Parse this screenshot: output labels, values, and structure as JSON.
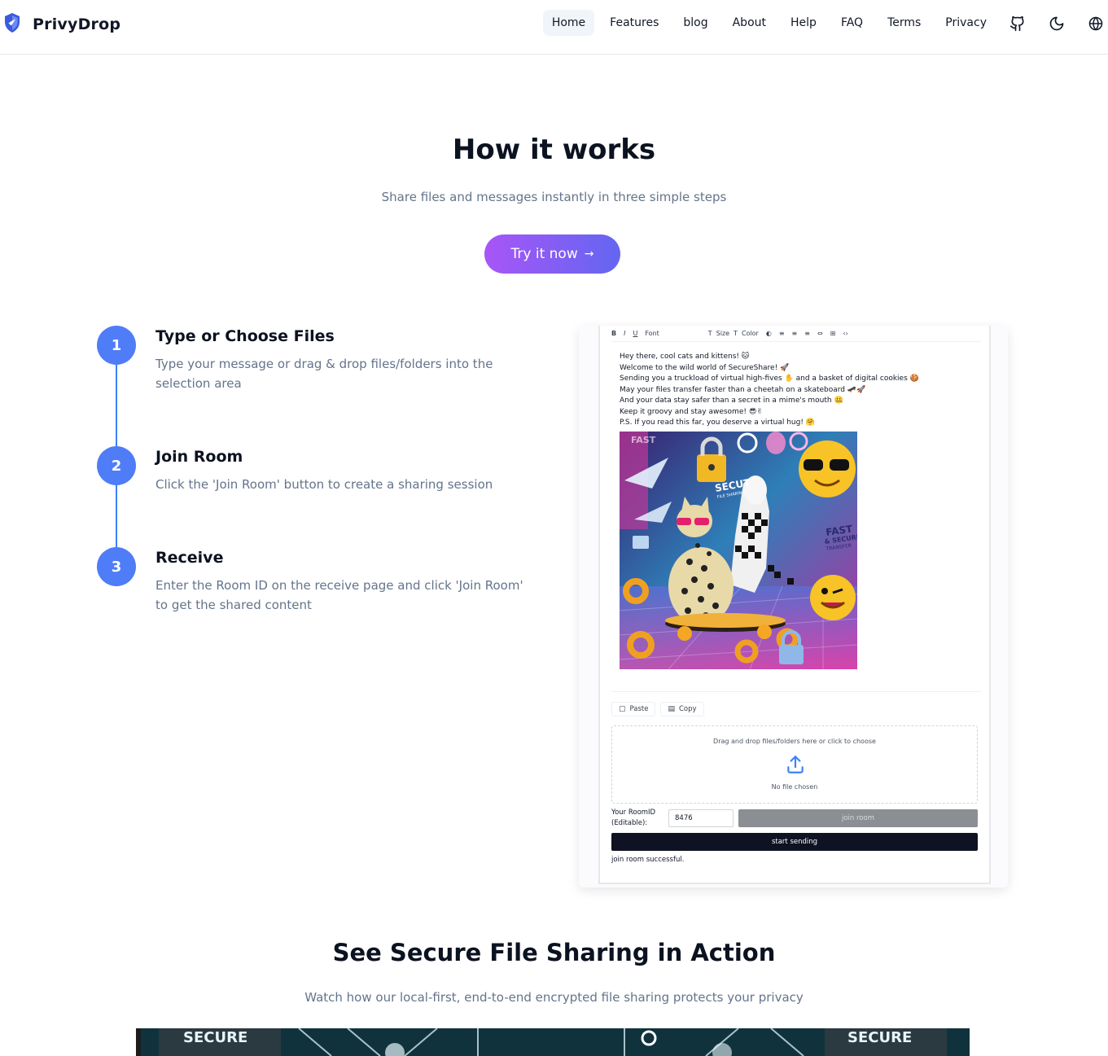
{
  "nav": {
    "brand": "PrivyDrop",
    "links": [
      "Home",
      "Features",
      "blog",
      "About",
      "Help",
      "FAQ",
      "Terms",
      "Privacy"
    ],
    "icons": [
      "github-icon",
      "moon-icon",
      "globe-icon"
    ]
  },
  "hero": {
    "title": "How it works",
    "subtitle": "Share files and messages instantly in three simple steps",
    "cta": "Try it now",
    "cta_arrow": "→"
  },
  "steps": [
    {
      "number": "1",
      "title": "Type or Choose Files",
      "description": "Type your message or drag & drop files/folders into the selection area"
    },
    {
      "number": "2",
      "title": "Join Room",
      "description": "Click the 'Join Room' button to create a sharing session"
    },
    {
      "number": "3",
      "title": "Receive",
      "description": "Enter the Room ID on the receive page and click 'Join Room' to get the shared content"
    }
  ],
  "demo": {
    "toolbar": [
      "B",
      "I",
      "U",
      "Font",
      "T",
      "Size",
      "T",
      "Color",
      "◐",
      "≡",
      "≡",
      "≡",
      "⇔",
      "⊞",
      "‹›"
    ],
    "message_lines": [
      "Hey there, cool cats and kittens! 🐱",
      "Welcome to the wild world of SecureShare! 🚀",
      "Sending you a truckload of virtual high-fives ✋ and a basket of digital cookies 🍪",
      "May your files transfer faster than a cheetah on a skateboard 🛹🚀",
      "And your data stay safer than a secret in a mime's mouth 🤐",
      "Keep it groovy and stay awesome! 😎✌",
      "P.S. If you read this far, you deserve a virtual hug! 🤗"
    ],
    "art_text": {
      "fast": "FAST",
      "secure": "SECUT",
      "sub": "FILE SHARING",
      "fast2": "FAST",
      "secure2": "& SECURE",
      "transfer": "TRANSFER"
    },
    "paste": "Paste",
    "copy": "Copy",
    "dropzone_text": "Drag and drop files/folders here or click to choose",
    "no_file": "No file chosen",
    "room_label_1": "Your RoomID",
    "room_label_2": "(Editable):",
    "room_id": "8476",
    "join_button": "join room",
    "send_button": "start sending",
    "status": "join room successful."
  },
  "section2": {
    "title": "See Secure File Sharing in Action",
    "subtitle": "Watch how our local-first, end-to-end encrypted file sharing protects your privacy",
    "video_text_left": "SECURE",
    "video_text_right": "SECURE"
  }
}
